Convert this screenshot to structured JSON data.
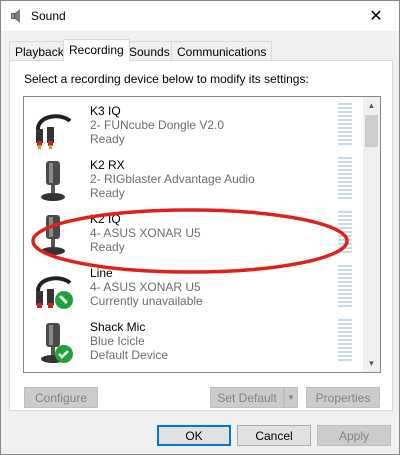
{
  "window": {
    "title": "Sound",
    "close_icon": "close-icon"
  },
  "tabs": [
    {
      "label": "Playback",
      "active": false
    },
    {
      "label": "Recording",
      "active": true
    },
    {
      "label": "Sounds",
      "active": false
    },
    {
      "label": "Communications",
      "active": false
    }
  ],
  "instruction": "Select a recording device below to modify its settings:",
  "devices": [
    {
      "name": "K3 IQ",
      "description": "2- FUNcube Dongle V2.0",
      "status": "Ready",
      "icon": "line-in-icon"
    },
    {
      "name": "K2 RX",
      "description": "2- RIGblaster Advantage Audio",
      "status": "Ready",
      "icon": "microphone-icon"
    },
    {
      "name": "K2 IQ",
      "description": "4- ASUS XONAR U5",
      "status": "Ready",
      "icon": "microphone-icon"
    },
    {
      "name": "Line",
      "description": "4- ASUS XONAR U5",
      "status": "Currently unavailable",
      "icon": "line-in-icon",
      "badge": "phone-badge"
    },
    {
      "name": "Shack Mic",
      "description": "Blue Icicle",
      "status": "Default Device",
      "icon": "microphone-icon",
      "badge": "default-check-badge"
    }
  ],
  "buttons": {
    "configure": "Configure",
    "set_default": "Set Default",
    "properties": "Properties",
    "ok": "OK",
    "cancel": "Cancel",
    "apply": "Apply"
  },
  "colors": {
    "annotation": "#e0201a",
    "accent": "#0078d7",
    "badge_green": "#1fa33a"
  }
}
